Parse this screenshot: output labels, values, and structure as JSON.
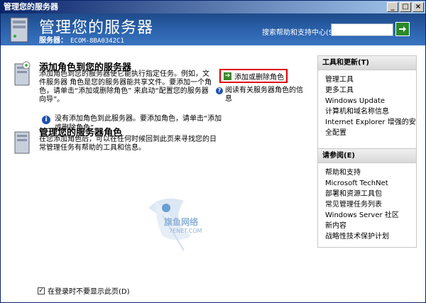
{
  "window": {
    "title": "管理您的服务器",
    "controls": [
      "_",
      "□",
      "×"
    ]
  },
  "header": {
    "title": "管理您的服务器",
    "server_label": "服务器：",
    "server_name": "ECOM-8BA0342C1",
    "search_label": "搜索帮助和支持中心(S)",
    "search_value": ""
  },
  "section_add": {
    "title": "添加角色到您的服务器",
    "text": "添加角色到您的服务器使它能执行指定任务。例如，文件服务器 角色是您的服务器能共享文件。要添加一个角色，请单击“添加或删除角色” 来启动“配置您的服务器向导”。",
    "action_label": "添加或删除角色",
    "help_label": "阅读有关服务器角色的信息"
  },
  "section_manage": {
    "title": "管理您的服务器角色",
    "text": "在您添加角色后，可以在任何时候回到此页来寻找您的日常管理任务有帮助的工具和信息。",
    "info_text": "没有添加角色到此服务器。要添加角色，请单击“添加或删除角色”。"
  },
  "panel_tools": {
    "title": "工具和更新(T)",
    "items": [
      "管理工具",
      "更多工具",
      "Windows Update",
      "计算机和域名称信息",
      "Internet Explorer 增强的安全配置"
    ]
  },
  "panel_see_also": {
    "title": "请参阅(E)",
    "items": [
      "帮助和支持",
      "Microsoft TechNet",
      "部署和资源工具包",
      "常见管理任务列表",
      "Windows Server 社区",
      "新内容",
      "战略性技术保护计划"
    ]
  },
  "footer": {
    "checkbox_label": "在登录时不要显示此页(D)",
    "checked": true
  },
  "watermark": {
    "text": "旗鱼网络",
    "sub": "7ENET.COM"
  },
  "colors": {
    "header_blue": "#2d65b0",
    "title_bar": "#0a246a",
    "highlight_red": "#e00000",
    "go_green": "#2a8a2a"
  }
}
